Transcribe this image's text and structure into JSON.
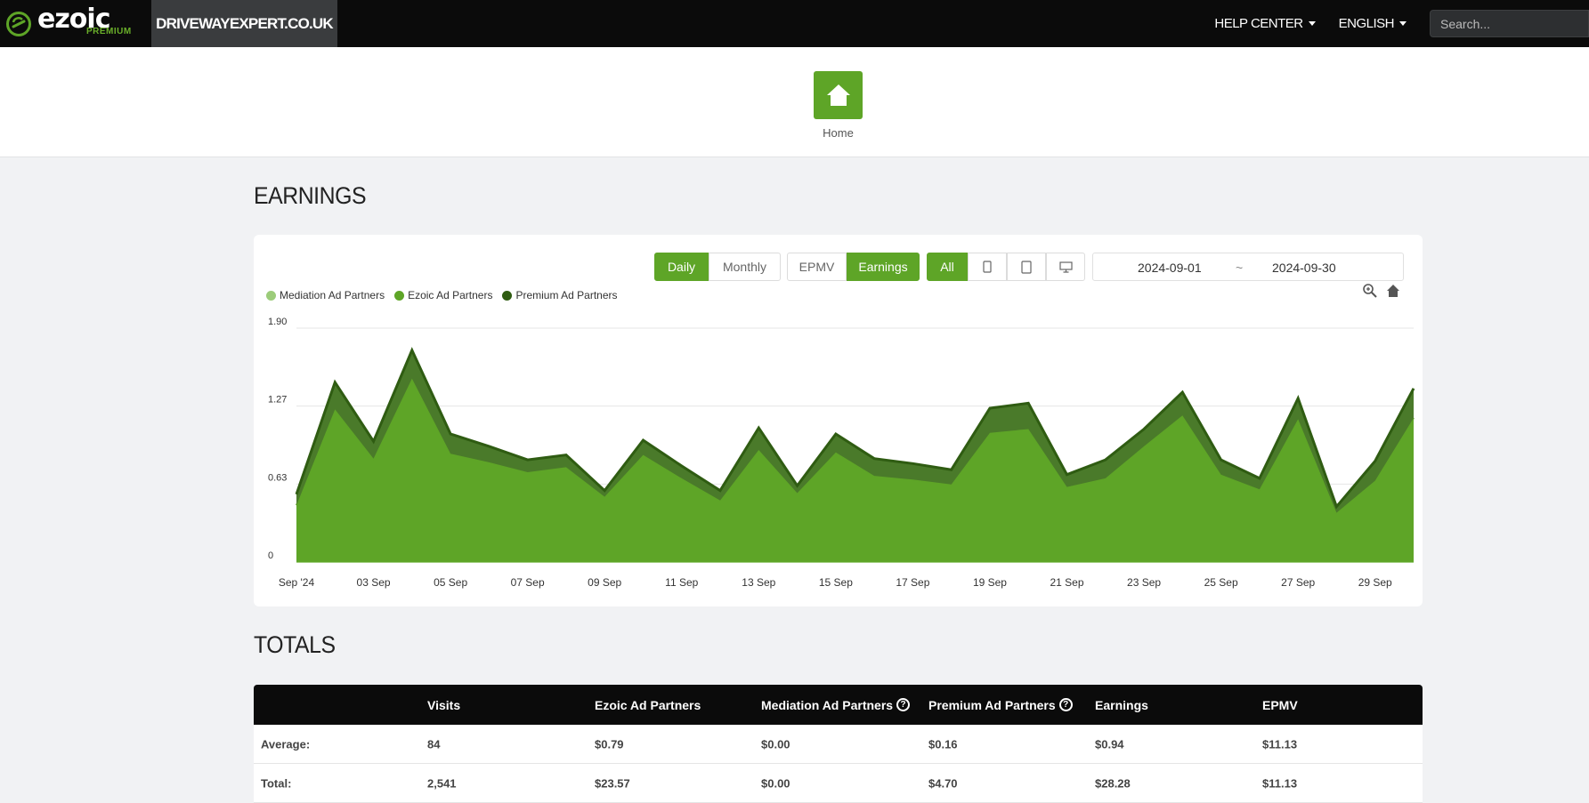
{
  "brand": {
    "name": "ezoic",
    "tier": "PREMIUM",
    "accent": "#5ea527"
  },
  "site": {
    "domain": "DRIVEWAYEXPERT.CO.UK"
  },
  "nav": {
    "help_center": "HELP CENTER",
    "language": "ENGLISH",
    "search_placeholder": "Search..."
  },
  "home": {
    "label": "Home",
    "icon": "home-icon"
  },
  "earnings": {
    "title": "EARNINGS",
    "period_toggle": [
      "Daily",
      "Monthly"
    ],
    "period_active": "Daily",
    "metric_toggle": [
      "EPMV",
      "Earnings"
    ],
    "metric_active": "Earnings",
    "device_all": "All",
    "device_icons": [
      "mobile-icon",
      "tablet-icon",
      "desktop-icon"
    ],
    "date_start": "2024-09-01",
    "date_separator": "~",
    "date_end": "2024-09-30"
  },
  "chart_data": {
    "type": "area",
    "stacked": true,
    "x": [
      "2024-09-01",
      "2024-09-02",
      "2024-09-03",
      "2024-09-04",
      "2024-09-05",
      "2024-09-06",
      "2024-09-07",
      "2024-09-08",
      "2024-09-09",
      "2024-09-10",
      "2024-09-11",
      "2024-09-12",
      "2024-09-13",
      "2024-09-14",
      "2024-09-15",
      "2024-09-16",
      "2024-09-17",
      "2024-09-18",
      "2024-09-19",
      "2024-09-20",
      "2024-09-21",
      "2024-09-22",
      "2024-09-23",
      "2024-09-24",
      "2024-09-25",
      "2024-09-26",
      "2024-09-27",
      "2024-09-28",
      "2024-09-29",
      "2024-09-30"
    ],
    "x_tick_labels": [
      "Sep '24",
      "03 Sep",
      "05 Sep",
      "07 Sep",
      "09 Sep",
      "11 Sep",
      "13 Sep",
      "15 Sep",
      "17 Sep",
      "19 Sep",
      "21 Sep",
      "23 Sep",
      "25 Sep",
      "27 Sep",
      "29 Sep"
    ],
    "y_tick_labels": [
      "0",
      "0.63",
      "1.27",
      "1.90"
    ],
    "ylim": [
      0,
      1.9
    ],
    "series": [
      {
        "name": "Mediation Ad Partners",
        "color": "#9ccc7a",
        "values": [
          0,
          0,
          0,
          0,
          0,
          0,
          0,
          0,
          0,
          0,
          0,
          0,
          0,
          0,
          0,
          0,
          0,
          0,
          0,
          0,
          0,
          0,
          0,
          0,
          0,
          0,
          0,
          0,
          0,
          0
        ]
      },
      {
        "name": "Ezoic Ad Partners",
        "color": "#5ea527",
        "values": [
          0.46,
          1.24,
          0.84,
          1.49,
          0.88,
          0.81,
          0.73,
          0.77,
          0.53,
          0.87,
          0.68,
          0.5,
          0.91,
          0.56,
          0.89,
          0.7,
          0.67,
          0.63,
          1.05,
          1.08,
          0.61,
          0.68,
          0.94,
          1.19,
          0.71,
          0.59,
          1.16,
          0.4,
          0.66,
          1.17
        ]
      },
      {
        "name": "Premium Ad Partners",
        "color": "#2f5c12",
        "values": [
          0.09,
          0.22,
          0.14,
          0.23,
          0.16,
          0.13,
          0.1,
          0.1,
          0.05,
          0.12,
          0.1,
          0.08,
          0.18,
          0.06,
          0.15,
          0.14,
          0.13,
          0.12,
          0.2,
          0.21,
          0.1,
          0.15,
          0.14,
          0.19,
          0.12,
          0.09,
          0.17,
          0.05,
          0.16,
          0.24
        ]
      }
    ],
    "legend_position": "top-left",
    "grid": true
  },
  "totals": {
    "title": "TOTALS",
    "columns": [
      "",
      "Visits",
      "Ezoic Ad Partners",
      "Mediation Ad Partners",
      "Premium Ad Partners",
      "Earnings",
      "EPMV"
    ],
    "rows": [
      [
        "Average:",
        "84",
        "$0.79",
        "$0.00",
        "$0.16",
        "$0.94",
        "$11.13"
      ],
      [
        "Total:",
        "2,541",
        "$23.57",
        "$0.00",
        "$4.70",
        "$28.28",
        "$11.13"
      ]
    ]
  }
}
